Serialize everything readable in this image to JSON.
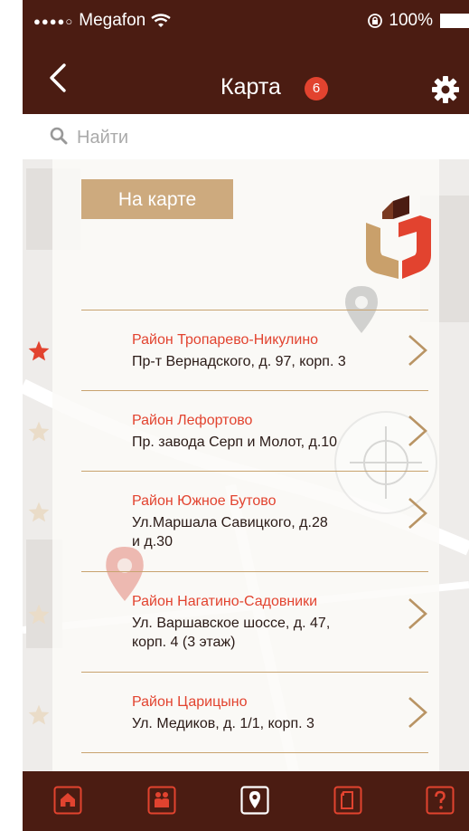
{
  "status": {
    "carrier": "Megafon",
    "battery": "100%",
    "signal_dots": "●●●●○"
  },
  "nav": {
    "title": "Карта",
    "badge": "6"
  },
  "search": {
    "placeholder": "Найти"
  },
  "onmap_label": "На карте",
  "items": [
    {
      "district": "Район Тропарево-Никулино",
      "address": "Пр-т Вернадского, д. 97, корп. 3",
      "favorite": true
    },
    {
      "district": "Район Лефортово",
      "address": "Пр. завода Серп и Молот, д.10",
      "favorite": false
    },
    {
      "district": "Район Южное Бутово",
      "address": "Ул.Маршала Савицкого, д.28 и д.30",
      "favorite": false
    },
    {
      "district": "Район Нагатино-Садовники",
      "address": "Ул. Варшавское шоссе, д. 47, корп. 4 (3 этаж)",
      "favorite": false
    },
    {
      "district": "Район Царицыно",
      "address": "Ул. Медиков, д. 1/1, корп. 3",
      "favorite": false
    }
  ],
  "tabs": [
    {
      "name": "home-icon",
      "active": false
    },
    {
      "name": "people-icon",
      "active": false
    },
    {
      "name": "map-pin-icon",
      "active": true
    },
    {
      "name": "document-icon",
      "active": false
    },
    {
      "name": "help-icon",
      "active": false
    }
  ],
  "colors": {
    "brand": "#4b1c12",
    "accent": "#e2432f",
    "gold": "#cdaa7e",
    "line": "#c8a36f",
    "star_inactive": "#eadcc8"
  }
}
